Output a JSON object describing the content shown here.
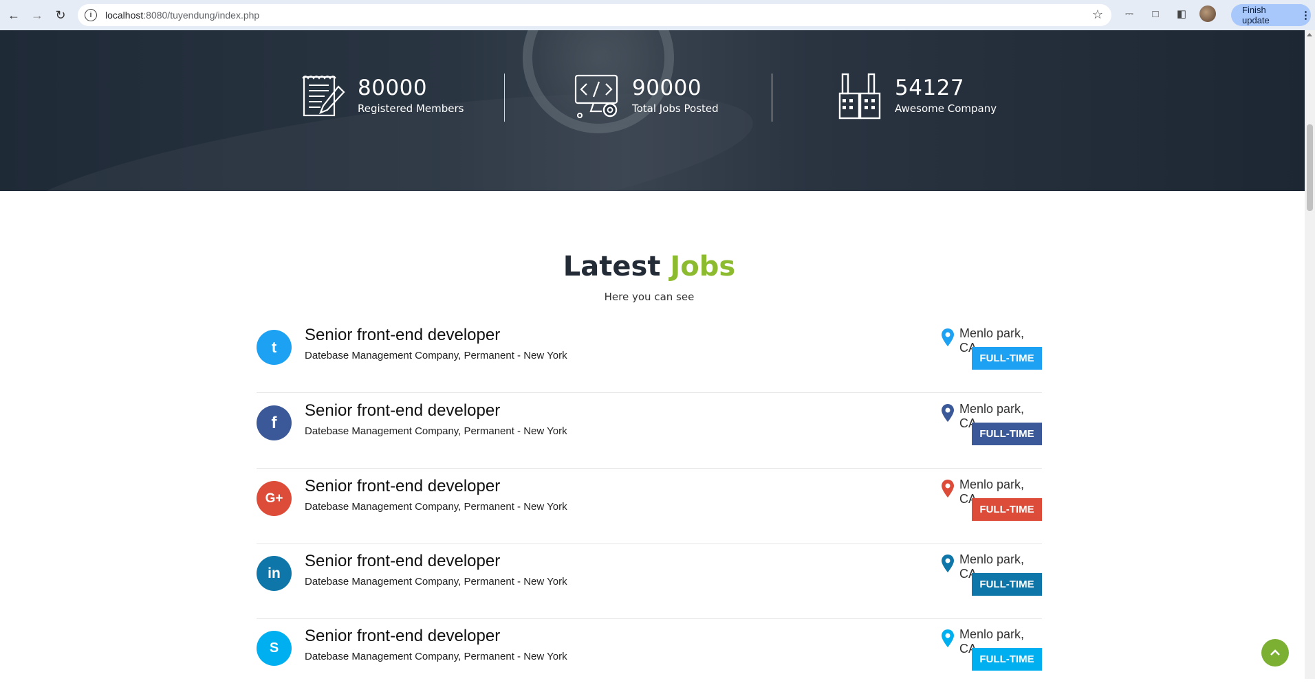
{
  "browser": {
    "url_host": "localhost",
    "url_rest": ":8080/tuyendung/index.php",
    "update_label": "Finish update"
  },
  "stats": [
    {
      "number": "80000",
      "label": "Registered Members",
      "icon": "document-pencil-icon"
    },
    {
      "number": "90000",
      "label": "Total Jobs Posted",
      "icon": "computer-code-icon"
    },
    {
      "number": "54127",
      "label": "Awesome Company",
      "icon": "factory-icon"
    }
  ],
  "latest": {
    "title_main": "Latest",
    "title_accent": "Jobs",
    "subtitle": "Here you can see",
    "accent_color": "#8dbb30"
  },
  "jobs": [
    {
      "network": "twitter",
      "logo_text": "t",
      "title": "Senior front-end developer",
      "company": "Datebase Management Company, Permanent - New York",
      "location": "Menlo park, CA",
      "type": "FULL-TIME",
      "color": "#1da1f2"
    },
    {
      "network": "facebook",
      "logo_text": "f",
      "title": "Senior front-end developer",
      "company": "Datebase Management Company, Permanent - New York",
      "location": "Menlo park, CA",
      "type": "FULL-TIME",
      "color": "#3b5998"
    },
    {
      "network": "google-plus",
      "logo_text": "G+",
      "title": "Senior front-end developer",
      "company": "Datebase Management Company, Permanent - New York",
      "location": "Menlo park, CA",
      "type": "FULL-TIME",
      "color": "#dd4b39"
    },
    {
      "network": "linkedin",
      "logo_text": "in",
      "title": "Senior front-end developer",
      "company": "Datebase Management Company, Permanent - New York",
      "location": "Menlo park, CA",
      "type": "FULL-TIME",
      "color": "#0e76a8"
    },
    {
      "network": "skype",
      "logo_text": "S",
      "title": "Senior front-end developer",
      "company": "Datebase Management Company, Permanent - New York",
      "location": "Menlo park, CA",
      "type": "FULL-TIME",
      "color": "#00aff0"
    }
  ]
}
